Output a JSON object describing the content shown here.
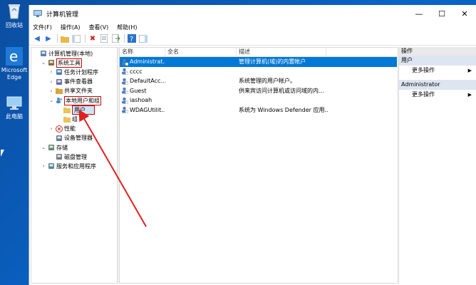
{
  "desktop": {
    "icons": [
      {
        "label": "回收站"
      },
      {
        "label": "Microsoft Edge"
      },
      {
        "label": "此电脑"
      }
    ]
  },
  "window": {
    "title": "计算机管理",
    "controls": {
      "minimize": "—",
      "maximize": "☐",
      "close": "✕"
    }
  },
  "menu": [
    "文件(F)",
    "操作(A)",
    "查看(V)",
    "帮助(H)"
  ],
  "tree": [
    {
      "label": "计算机管理(本地)",
      "level": 0,
      "expander": "",
      "icon": "computer-icon"
    },
    {
      "label": "系统工具",
      "level": 1,
      "expander": "⌄",
      "icon": "tools-icon",
      "highlight": true
    },
    {
      "label": "任务计划程序",
      "level": 2,
      "expander": "›",
      "icon": "clock-icon"
    },
    {
      "label": "事件查看器",
      "level": 2,
      "expander": "›",
      "icon": "event-icon"
    },
    {
      "label": "共享文件夹",
      "level": 2,
      "expander": "›",
      "icon": "share-folder-icon"
    },
    {
      "label": "本地用户和组",
      "level": 2,
      "expander": "⌄",
      "icon": "users-icon",
      "highlight": true
    },
    {
      "label": "用户",
      "level": 3,
      "expander": "",
      "icon": "folder-icon",
      "selected": true
    },
    {
      "label": "组",
      "level": 3,
      "expander": "",
      "icon": "folder-icon"
    },
    {
      "label": "性能",
      "level": 2,
      "expander": "›",
      "icon": "performance-icon"
    },
    {
      "label": "设备管理器",
      "level": 2,
      "expander": "",
      "icon": "device-icon"
    },
    {
      "label": "存储",
      "level": 1,
      "expander": "⌄",
      "icon": "storage-icon"
    },
    {
      "label": "磁盘管理",
      "level": 2,
      "expander": "",
      "icon": "disk-icon"
    },
    {
      "label": "服务和应用程序",
      "level": 1,
      "expander": "›",
      "icon": "services-icon"
    }
  ],
  "list": {
    "columns": [
      "名称",
      "全名",
      "描述"
    ],
    "rows": [
      {
        "name": "Administrat...",
        "fullname": "",
        "desc": "管理计算机(域)的内置帐户",
        "selected": true
      },
      {
        "name": "cccc",
        "fullname": "",
        "desc": ""
      },
      {
        "name": "DefaultAcc...",
        "fullname": "",
        "desc": "系统管理的用户帐户。"
      },
      {
        "name": "Guest",
        "fullname": "",
        "desc": "供来宾访问计算机或访问域的内..."
      },
      {
        "name": "iashoah",
        "fullname": "",
        "desc": ""
      },
      {
        "name": "WDAGUtilit...",
        "fullname": "",
        "desc": "系统为 Windows Defender 应用..."
      }
    ]
  },
  "actions": {
    "header": "操作",
    "sections": [
      {
        "title": "用户",
        "items": [
          {
            "label": "更多操作",
            "arrow": "▶"
          }
        ]
      },
      {
        "title": "Administrator",
        "items": [
          {
            "label": "更多操作",
            "arrow": "▶"
          }
        ]
      }
    ]
  },
  "colors": {
    "selection": "#0078d7",
    "annotation": "#e02020",
    "desktop": "#0a5fb4"
  }
}
